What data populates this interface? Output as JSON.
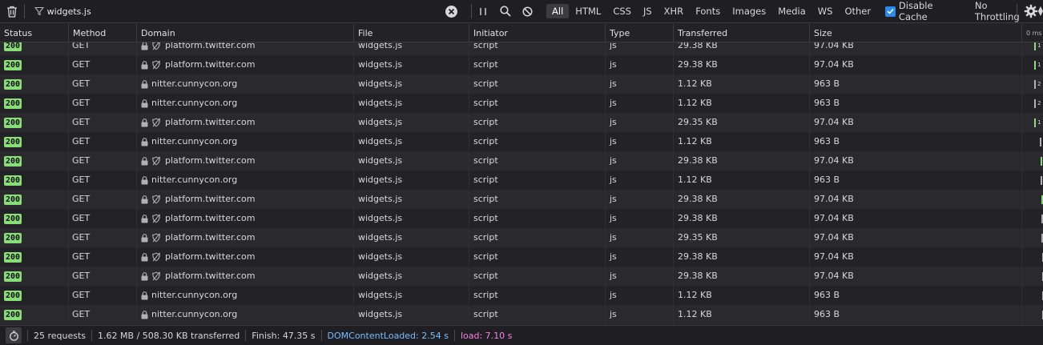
{
  "toolbar": {
    "filter_value": "widgets.js",
    "type_filters": [
      "All",
      "HTML",
      "CSS",
      "JS",
      "XHR",
      "Fonts",
      "Images",
      "Media",
      "WS",
      "Other"
    ],
    "active_filter": "All",
    "disable_cache_label": "Disable Cache",
    "disable_cache_checked": true,
    "throttling_label": "No Throttling"
  },
  "columns": [
    "Status",
    "Method",
    "Domain",
    "File",
    "Initiator",
    "Type",
    "Transferred",
    "Size"
  ],
  "waterfall_header": "0 ms",
  "colors": {
    "status_ok": "#86de74",
    "dom_content_loaded": "#75bfff",
    "load": "#ff7de9"
  },
  "rows": [
    {
      "status": "200",
      "method": "GET",
      "domain": "platform.twitter.com",
      "tracker": true,
      "file": "widgets.js",
      "initiator": "script",
      "type": "js",
      "transferred": "29.38 KB",
      "size": "97.04 KB",
      "wf_label": "1"
    },
    {
      "status": "200",
      "method": "GET",
      "domain": "platform.twitter.com",
      "tracker": true,
      "file": "widgets.js",
      "initiator": "script",
      "type": "js",
      "transferred": "29.38 KB",
      "size": "97.04 KB",
      "wf_label": "1"
    },
    {
      "status": "200",
      "method": "GET",
      "domain": "nitter.cunnycon.org",
      "tracker": false,
      "file": "widgets.js",
      "initiator": "script",
      "type": "js",
      "transferred": "1.12 KB",
      "size": "963 B",
      "wf_label": "2"
    },
    {
      "status": "200",
      "method": "GET",
      "domain": "nitter.cunnycon.org",
      "tracker": false,
      "file": "widgets.js",
      "initiator": "script",
      "type": "js",
      "transferred": "1.12 KB",
      "size": "963 B",
      "wf_label": "2"
    },
    {
      "status": "200",
      "method": "GET",
      "domain": "platform.twitter.com",
      "tracker": true,
      "file": "widgets.js",
      "initiator": "script",
      "type": "js",
      "transferred": "29.35 KB",
      "size": "97.04 KB",
      "wf_label": "1"
    },
    {
      "status": "200",
      "method": "GET",
      "domain": "nitter.cunnycon.org",
      "tracker": false,
      "file": "widgets.js",
      "initiator": "script",
      "type": "js",
      "transferred": "1.12 KB",
      "size": "963 B",
      "wf_label": ""
    },
    {
      "status": "200",
      "method": "GET",
      "domain": "platform.twitter.com",
      "tracker": true,
      "file": "widgets.js",
      "initiator": "script",
      "type": "js",
      "transferred": "29.38 KB",
      "size": "97.04 KB",
      "wf_label": ""
    },
    {
      "status": "200",
      "method": "GET",
      "domain": "nitter.cunnycon.org",
      "tracker": false,
      "file": "widgets.js",
      "initiator": "script",
      "type": "js",
      "transferred": "1.12 KB",
      "size": "963 B",
      "wf_label": ""
    },
    {
      "status": "200",
      "method": "GET",
      "domain": "platform.twitter.com",
      "tracker": true,
      "file": "widgets.js",
      "initiator": "script",
      "type": "js",
      "transferred": "29.38 KB",
      "size": "97.04 KB",
      "wf_label": ""
    },
    {
      "status": "200",
      "method": "GET",
      "domain": "platform.twitter.com",
      "tracker": true,
      "file": "widgets.js",
      "initiator": "script",
      "type": "js",
      "transferred": "29.38 KB",
      "size": "97.04 KB",
      "wf_label": ""
    },
    {
      "status": "200",
      "method": "GET",
      "domain": "platform.twitter.com",
      "tracker": true,
      "file": "widgets.js",
      "initiator": "script",
      "type": "js",
      "transferred": "29.35 KB",
      "size": "97.04 KB",
      "wf_label": ""
    },
    {
      "status": "200",
      "method": "GET",
      "domain": "platform.twitter.com",
      "tracker": true,
      "file": "widgets.js",
      "initiator": "script",
      "type": "js",
      "transferred": "29.38 KB",
      "size": "97.04 KB",
      "wf_label": ""
    },
    {
      "status": "200",
      "method": "GET",
      "domain": "platform.twitter.com",
      "tracker": true,
      "file": "widgets.js",
      "initiator": "script",
      "type": "js",
      "transferred": "29.38 KB",
      "size": "97.04 KB",
      "wf_label": ""
    },
    {
      "status": "200",
      "method": "GET",
      "domain": "nitter.cunnycon.org",
      "tracker": false,
      "file": "widgets.js",
      "initiator": "script",
      "type": "js",
      "transferred": "1.12 KB",
      "size": "963 B",
      "wf_label": ""
    },
    {
      "status": "200",
      "method": "GET",
      "domain": "nitter.cunnycon.org",
      "tracker": false,
      "file": "widgets.js",
      "initiator": "script",
      "type": "js",
      "transferred": "1.12 KB",
      "size": "963 B",
      "wf_label": ""
    }
  ],
  "footer": {
    "requests": "25 requests",
    "transferred": "1.62 MB / 508.30 KB transferred",
    "finish": "Finish: 47.35 s",
    "dom_content_loaded": "DOMContentLoaded: 2.54 s",
    "load": "load: 7.10 s"
  }
}
